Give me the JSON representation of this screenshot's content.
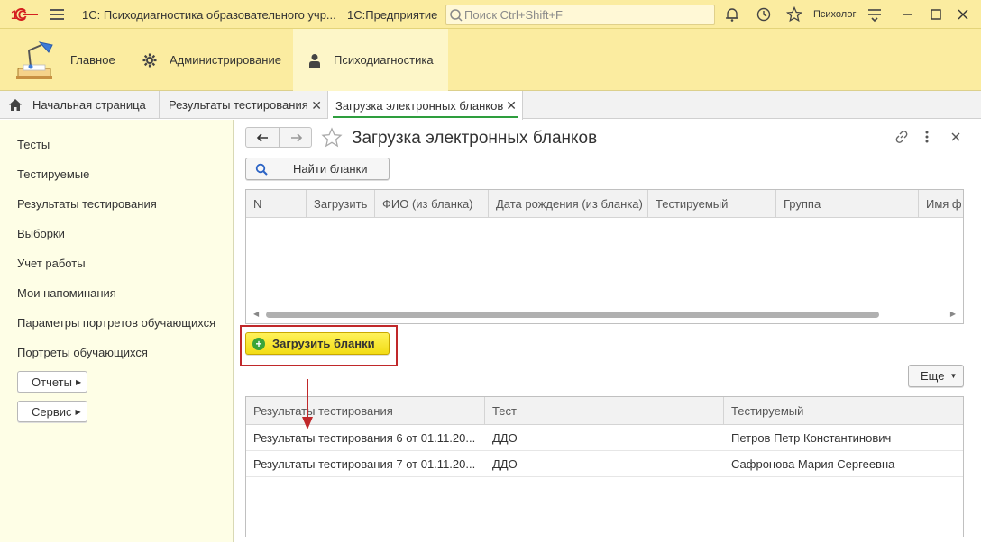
{
  "titlebar": {
    "app_title": "1С: Психодиагностика образовательного учр...",
    "platform": "1С:Предприятие",
    "search_placeholder": "Поиск Ctrl+Shift+F",
    "user": "Психолог",
    "icons": [
      "bell-icon",
      "history-icon",
      "star-icon",
      "settings-icon",
      "minimize-icon",
      "maximize-icon",
      "close-icon"
    ]
  },
  "sections": [
    {
      "label": "Главное",
      "icon": "desk-lamp-icon"
    },
    {
      "label": "Администрирование",
      "icon": "gear-icon"
    },
    {
      "label": "Психодиагностика",
      "icon": "person-icon"
    }
  ],
  "tabs": [
    {
      "label": "Начальная страница",
      "icon": "home-icon"
    },
    {
      "label": "Результаты тестирования"
    },
    {
      "label": "Загрузка электронных бланков"
    }
  ],
  "leftnav": {
    "items": [
      "Тесты",
      "Тестируемые",
      "Результаты тестирования",
      "Выборки",
      "Учет работы",
      "Мои напоминания",
      "Параметры портретов обучающихся",
      "Портреты обучающихся"
    ],
    "buttons": [
      "Отчеты",
      "Сервис"
    ]
  },
  "form": {
    "title": "Загрузка электронных бланков",
    "find_button": "Найти бланки",
    "load_button": "Загрузить бланки",
    "more_button": "Еще"
  },
  "grid1": {
    "columns": [
      "N",
      "Загрузить",
      "ФИО (из бланка)",
      "Дата рождения (из бланка)",
      "Тестируемый",
      "Группа",
      "Имя ф"
    ]
  },
  "grid2": {
    "columns": [
      "Результаты тестирования",
      "Тест",
      "Тестируемый"
    ],
    "rows": [
      [
        "Результаты тестирования 6 от 01.11.20...",
        "ДДО",
        "Петров Петр Константинович"
      ],
      [
        "Результаты тестирования 7 от 01.11.20...",
        "ДДО",
        "Сафронова Мария Сергеевна"
      ]
    ]
  },
  "colors": {
    "accent_yellow": "#fbeca0",
    "active_underline": "#2e9e3e",
    "highlight_red": "#c0282a",
    "button_yellow": "#f2dc14"
  }
}
